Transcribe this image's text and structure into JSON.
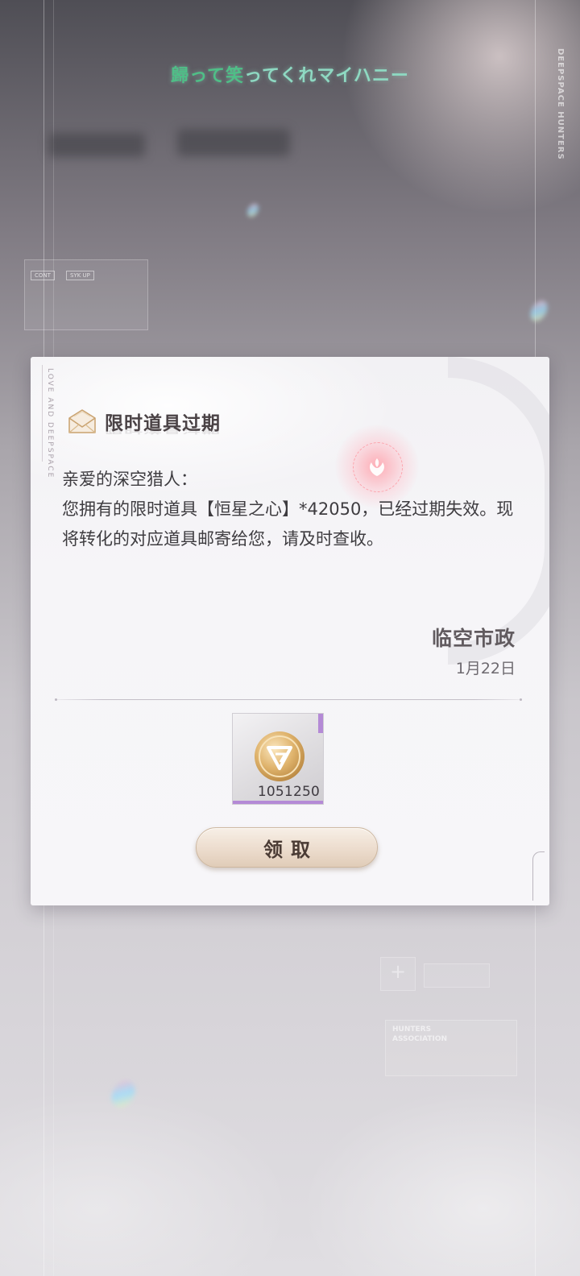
{
  "background": {
    "lyric_highlight": "歸って笑",
    "lyric_rest": "ってくれマイハニー",
    "brand_vertical": "DEEPSPACE HUNTERS",
    "hunters_association": "HUNTERS ASSOCIATION",
    "ghost_tags": [
      "CONT",
      "SYK UP"
    ]
  },
  "mail": {
    "title": "限时道具过期",
    "greeting": "亲爱的深空猎人：",
    "body": "您拥有的限时道具【恒星之心】*42050，已经过期失效。现将转化的对应道具邮寄给您，请及时查收。",
    "sender": "临空市政",
    "date": "1月22日",
    "side_text": "LOVE AND DEEPSPACE",
    "attachment": {
      "icon": "gold-coin-icon",
      "count": "1051250",
      "rarity_color": "#b48ad6"
    },
    "claim_label": "领取"
  },
  "colors": {
    "accent_gold": "#d9a960",
    "lyric_green": "#4fbf87",
    "button_bg": "#ecdccd"
  }
}
